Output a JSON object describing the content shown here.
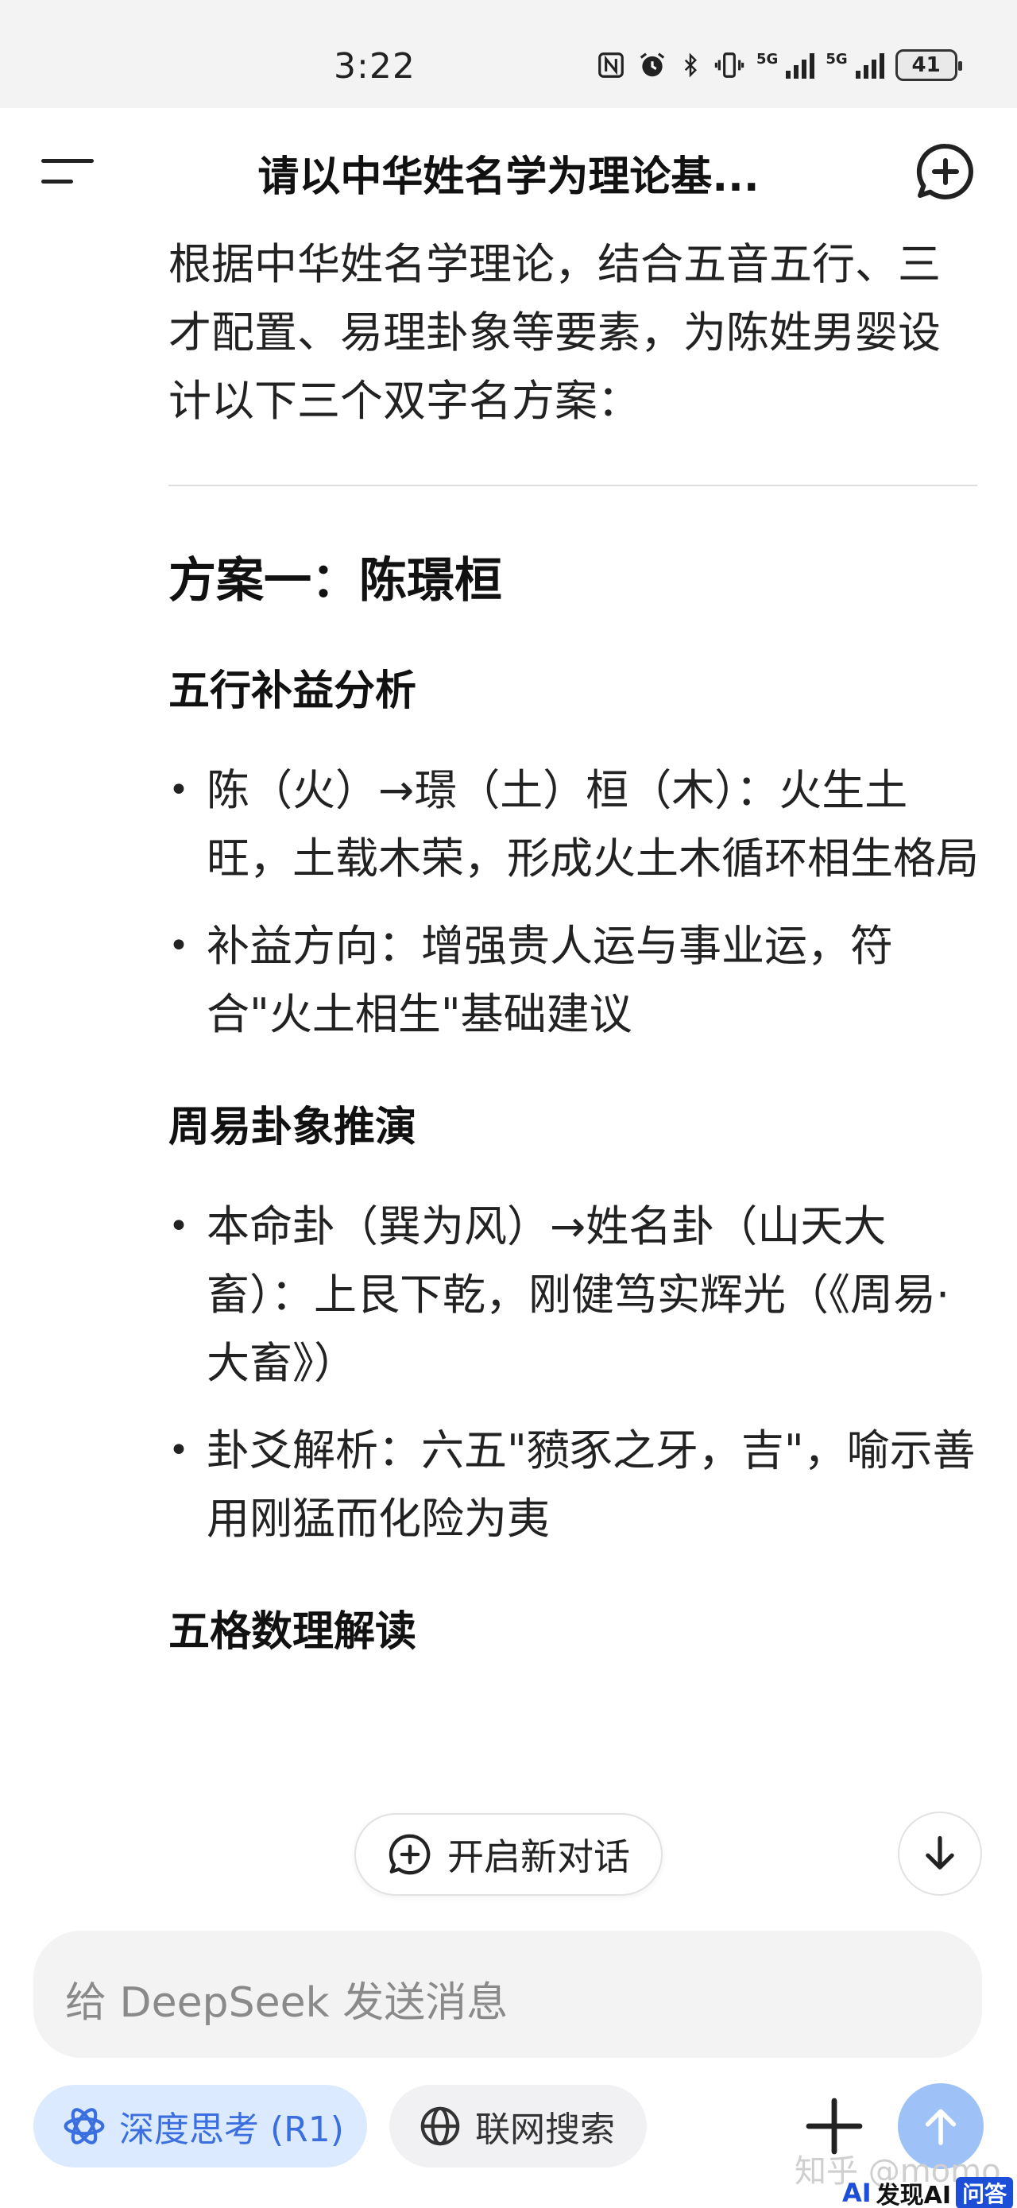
{
  "status_bar": {
    "time": "3:22",
    "network_1": "5G",
    "network_2": "5G",
    "battery": "41"
  },
  "header": {
    "title": "请以中华姓名学为理论基...",
    "menu_icon": "menu-icon",
    "new_chat_icon": "new-chat-icon"
  },
  "content": {
    "intro": "根据中华姓名学理论，结合五音五行、三才配置、易理卦象等要素，为陈姓男婴设计以下三个双字名方案：",
    "plan_title": "方案一：陈璟桓",
    "sections": [
      {
        "heading": "五行补益分析",
        "bullets": [
          "陈（火）→璟（土）桓（木）：火生土旺，土载木荣，形成火土木循环相生格局",
          "补益方向：增强贵人运与事业运，符合\"火土相生\"基础建议"
        ]
      },
      {
        "heading": "周易卦象推演",
        "bullets": [
          "本命卦（巽为风）→姓名卦（山天大畜）：上艮下乾，刚健笃实辉光（《周易·大畜》）",
          "卦爻解析：六五\"豮豕之牙，吉\"，喻示善用刚猛而化险为夷"
        ]
      },
      {
        "heading": "五格数理解读",
        "bullets": []
      }
    ]
  },
  "floating": {
    "new_chat_label": "开启新对话"
  },
  "composer": {
    "placeholder": "给 DeepSeek 发送消息",
    "deep_think_label": "深度思考 (R1)",
    "web_search_label": "联网搜索"
  },
  "watermark": {
    "text": "知乎 @momo",
    "brand_logo": "AI",
    "brand_name": "发现AI",
    "brand_tag": "问答"
  },
  "colors": {
    "accent": "#3b6fe0",
    "accent_bg": "#dbeafe",
    "send_button": "#9ec2f7"
  }
}
